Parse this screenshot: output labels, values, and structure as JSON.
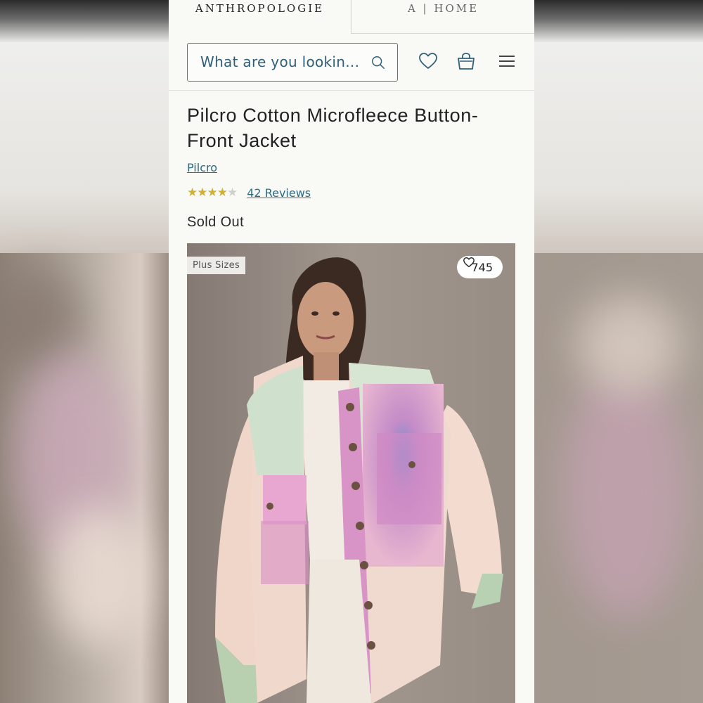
{
  "top_nav": {
    "brand": "ANTHROPOLOGIE",
    "home_tab": "A | HOME"
  },
  "search": {
    "placeholder": "What are you lookin...",
    "search_icon": "search-icon"
  },
  "header_icons": [
    "heart-icon",
    "shopping-bag-icon",
    "hamburger-menu-icon"
  ],
  "product": {
    "title": "Pilcro Cotton Microfleece Button-Front Jacket",
    "brand": "Pilcro",
    "rating": 4,
    "rating_max": 5,
    "reviews": "42 Reviews",
    "status": "Sold Out"
  },
  "image": {
    "badge": "Plus Sizes",
    "likes": "745",
    "like_icon": "heart-outline-icon"
  },
  "colors": {
    "link": "#2b6b84",
    "star": "#d0b035",
    "page_bg": "#f9f9f6"
  }
}
